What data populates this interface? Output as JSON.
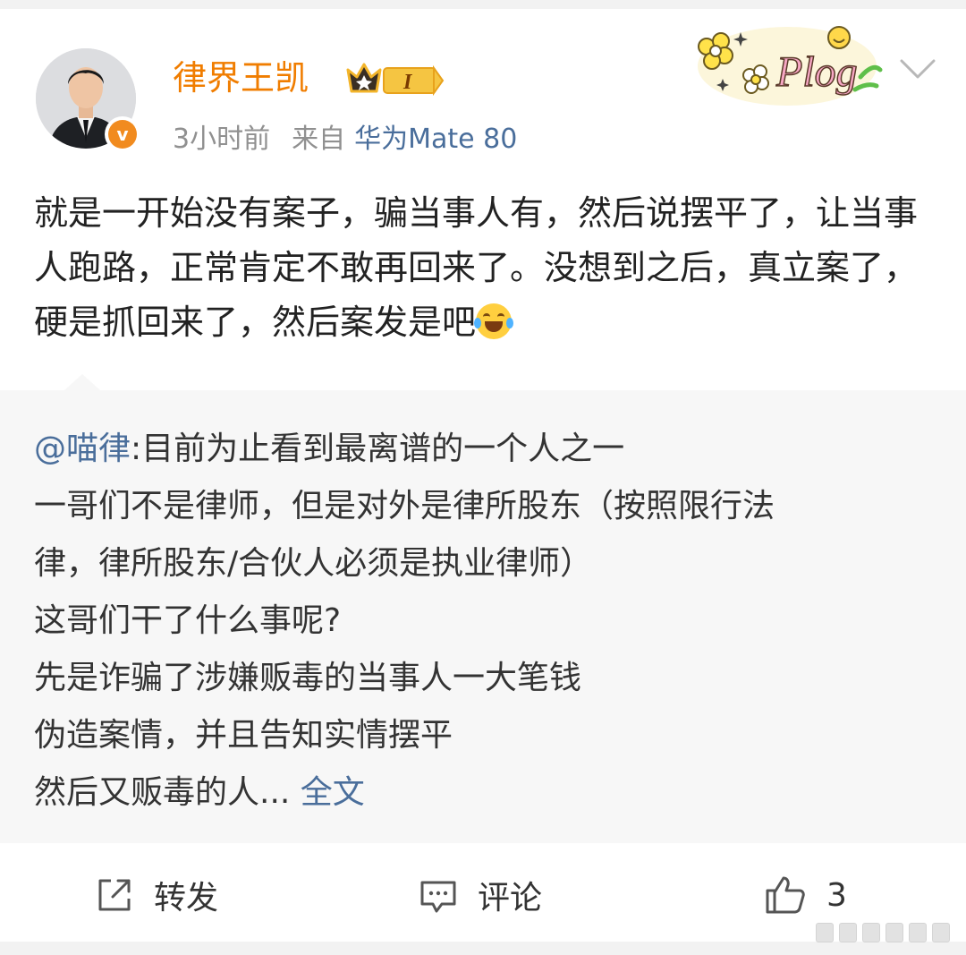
{
  "post": {
    "author": "律界王凯",
    "verified_glyph": "v",
    "level_badge": "I",
    "time": "3小时前",
    "source_prefix": "来自",
    "device": "华为Mate 80",
    "sticker_text": "Plog",
    "text": "就是一开始没有案子，骗当事人有，然后说摆平了，让当事人跑路，正常肯定不敢再回来了。没想到之后，真立案了，硬是抓回来了，然后案发是吧",
    "emoji": "laughing-tears-emoji"
  },
  "quote": {
    "mention": "@喵律",
    "lines": [
      ":目前为止看到最离谱的一个人之一",
      "一哥们不是律师，但是对外是律所股东（按照限行法",
      "律，律所股东/合伙人必须是执业律师）",
      "这哥们干了什么事呢?",
      "先是诈骗了涉嫌贩毒的当事人一大笔钱",
      "伪造案情，并且告知实情摆平",
      "然后又贩毒的人..."
    ],
    "more_label": "全文"
  },
  "actions": {
    "repost_label": "转发",
    "comment_label": "评论",
    "like_count": "3"
  },
  "colors": {
    "username": "#f07d00",
    "link": "#4a6e9b",
    "meta": "#909090",
    "quote_bg": "#f7f7f7"
  }
}
